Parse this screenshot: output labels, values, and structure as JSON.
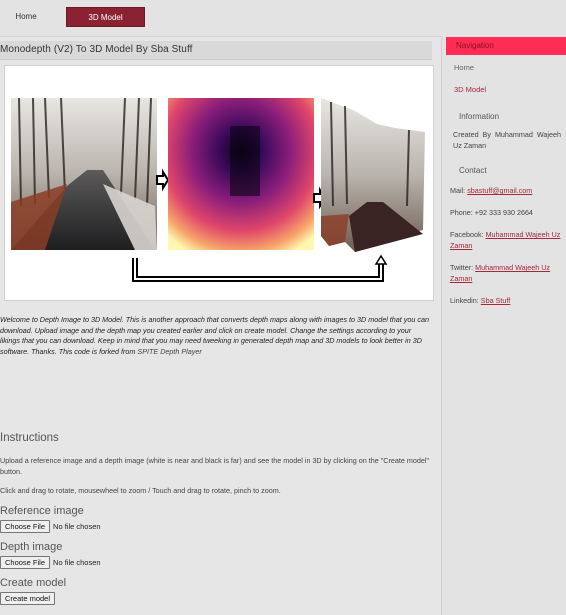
{
  "topnav": {
    "home": "Home",
    "model3d": "3D Model"
  },
  "main": {
    "title": "Monodepth (V2) To 3D Model By Sba Stuff",
    "description": "Welcome to Depth Image to 3D Model. This is another approach that converts depth maps along with images to 3D model that you can download. Upload image and the depth map you created earlier and click on create model. Change the settings according to your likings that you can download. Keep in mind that you may need tweeking in generated depth map and 3D models to look better in 3D software. Thanks. This code is forked from",
    "description_link": "SPITE Depth Player",
    "instructions_heading": "Instructions",
    "instructions_p1": "Upload a reference image and a depth image (white is near and black is far) and see the model in 3D by clicking on the \"Create model\" button.",
    "instructions_p2": "Click and drag to rotate, mousewheel to zoom / Touch and drag to rotate, pinch to zoom.",
    "reference_heading": "Reference image",
    "depth_heading": "Depth image",
    "choose_file": "Choose File",
    "no_file": "No file chosen",
    "create_heading": "Create model",
    "create_button": "Create model"
  },
  "sidebar": {
    "nav_heading": "Navigation",
    "home": "Home",
    "model3d": "3D Model",
    "info_heading": "Information",
    "created_by": "Created By Muhammad Wajeeh Uz Zaman",
    "contact_heading": "Contact",
    "mail_label": "Mail:",
    "mail_value": "sbastuff@gmail.com",
    "phone": "Phone: +92 333 930 2664",
    "facebook_label": "Facebook:",
    "facebook_value": "Muhammad Wajeeh Uz Zaman",
    "twitter_label": "Twitter:",
    "twitter_value": "Muhammad Wajeeh Uz Zaman",
    "linkedin_label": "Linkedin:",
    "linkedin_value": "Sba Stuff"
  },
  "colors": {
    "accent": "#8b2232",
    "nav_heading_bg": "#ff2d55",
    "link": "#a3283b"
  }
}
